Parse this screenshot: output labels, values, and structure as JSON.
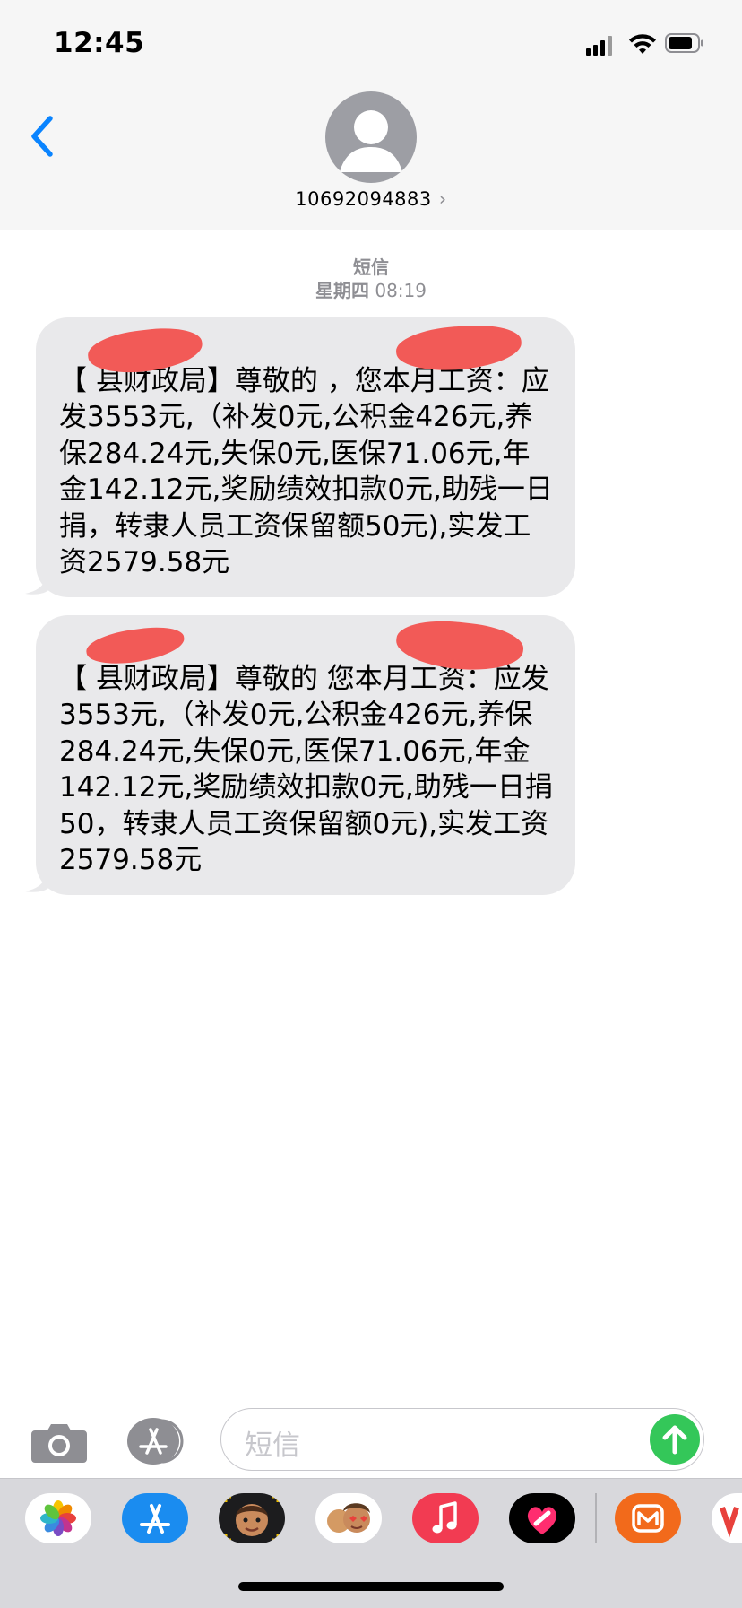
{
  "status_bar": {
    "time": "12:45"
  },
  "header": {
    "contact_number": "10692094883",
    "contact_chevron": "›"
  },
  "conversation": {
    "service_label": "短信",
    "weekday": "星期四",
    "clock": "08:19",
    "messages": [
      {
        "text": "【   县财政局】尊敬的    ，您本月工资：应发3553元,（补发0元,公积金426元,养保284.24元,失保0元,医保71.06元,年金142.12元,奖励绩效扣款0元,助残一日捐，转隶人员工资保留额50元),实发工资2579.58元"
      },
      {
        "text": "【   县财政局】尊敬的    您本月工资：应发3553元,（补发0元,公积金426元,养保284.24元,失保0元,医保71.06元,年金142.12元,奖励绩效扣款0元,助残一日捐50，转隶人员工资保留额0元),实发工资2579.58元"
      }
    ]
  },
  "composer": {
    "placeholder": "短信"
  },
  "colors": {
    "accent_blue": "#0a84ff",
    "send_green": "#34c759",
    "bubble_gray": "#e9e9eb",
    "redaction_red": "#f25a57"
  },
  "icons": {
    "back": "chevron-left-icon",
    "avatar": "person-icon",
    "camera": "camera-icon",
    "apps": "app-store-icon",
    "send": "arrow-up-icon"
  },
  "app_drawer": [
    {
      "name": "photos-app-icon"
    },
    {
      "name": "app-store-app-icon"
    },
    {
      "name": "memoji-app-icon"
    },
    {
      "name": "memoji-stickers-app-icon"
    },
    {
      "name": "music-app-icon"
    },
    {
      "name": "digital-touch-app-icon"
    },
    {
      "name": "mango-tv-app-icon"
    },
    {
      "name": "partial-app-icon"
    }
  ]
}
